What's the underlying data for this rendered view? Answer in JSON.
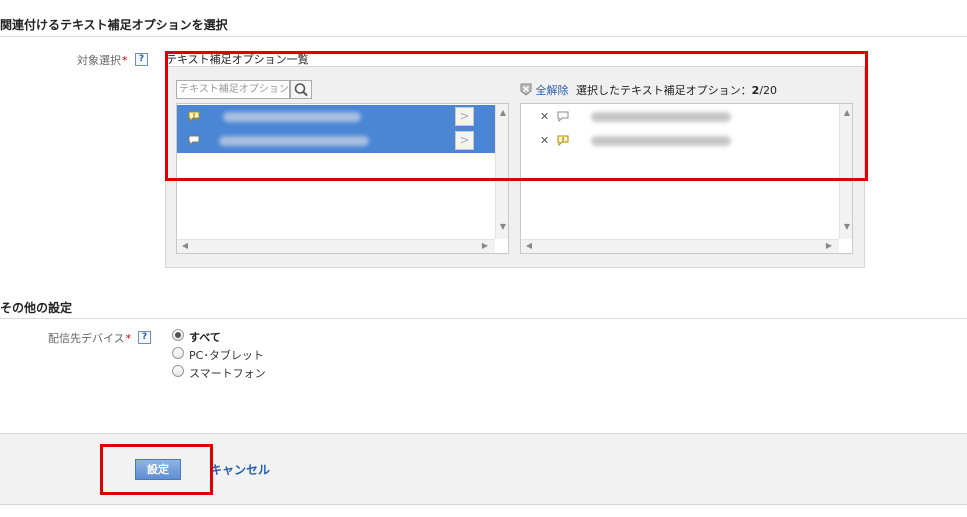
{
  "sections": {
    "link_title": "関連付けるテキスト補足オプションを選択",
    "other_title": "その他の設定"
  },
  "target": {
    "label": "対象選択",
    "required_mark": "*",
    "help": "?",
    "panel_heading": "テキスト補足オプション一覧"
  },
  "available": {
    "search_placeholder": "テキスト補足オプション",
    "items": [
      {
        "icon": "speech-bubble-exclaim-icon",
        "selected": true
      },
      {
        "icon": "speech-bubble-icon",
        "selected": true
      }
    ],
    "add_arrow": ">"
  },
  "chosen": {
    "clear_all_label": "全解除",
    "count_label": "選択したテキスト補足オプション：",
    "count_value": "2",
    "count_total": "/20",
    "remove_mark": "✕",
    "items": [
      {
        "icon": "speech-bubble-icon"
      },
      {
        "icon": "speech-bubble-exclaim-icon"
      }
    ]
  },
  "device": {
    "label": "配信先デバイス",
    "required_mark": "*",
    "help": "?",
    "options": [
      "すべて",
      "PC･タブレット",
      "スマートフォン"
    ],
    "selected": "すべて"
  },
  "footer": {
    "set_button": "設定",
    "cancel_link": "キャンセル"
  },
  "colors": {
    "selection": "#4a86d4",
    "link": "#2a5db0",
    "highlight_box": "#e00000",
    "required": "#dd0000"
  }
}
